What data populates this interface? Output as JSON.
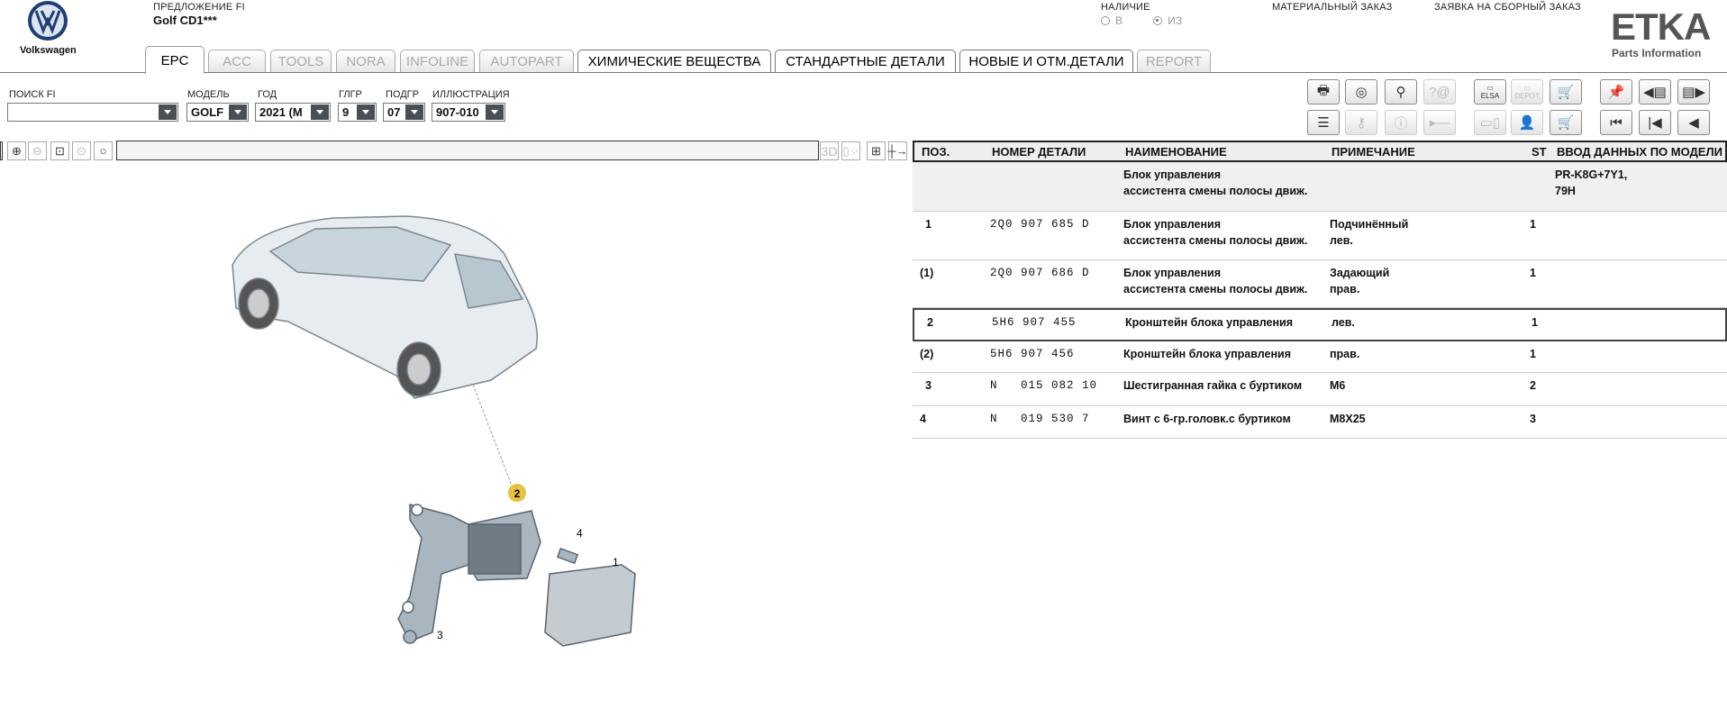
{
  "header": {
    "brand": "Volkswagen",
    "offer_label": "ПРЕДЛОЖЕНИЕ FI",
    "offer_value": "Golf CD1***",
    "availability_label": "НАЛИЧИЕ",
    "availability_options": [
      {
        "label": "В",
        "selected": false
      },
      {
        "label": "ИЗ",
        "selected": true
      }
    ],
    "material_order": "МАТЕРИАЛЬНЫЙ ЗАКАЗ",
    "assembly_order": "ЗАЯВКА НА СБОРНЫЙ ЗАКАЗ",
    "etka_logo": "ETKA",
    "etka_sub": "Parts Information"
  },
  "tabs": [
    {
      "label": "EPC",
      "state": "active"
    },
    {
      "label": "ACC",
      "state": "disabled"
    },
    {
      "label": "TOOLS",
      "state": "disabled"
    },
    {
      "label": "NORA",
      "state": "disabled"
    },
    {
      "label": "INFOLINE",
      "state": "disabled"
    },
    {
      "label": "AUTOPART",
      "state": "disabled"
    },
    {
      "label": "ХИМИЧЕСКИЕ ВЕЩЕСТВА",
      "state": "enabled"
    },
    {
      "label": "СТАНДАРТНЫЕ ДЕТАЛИ",
      "state": "enabled"
    },
    {
      "label": "НОВЫЕ И ОТМ.ДЕТАЛИ",
      "state": "enabled"
    },
    {
      "label": "REPORT",
      "state": "disabled"
    }
  ],
  "filters": [
    {
      "label": "ПОИСК FI",
      "value": ""
    },
    {
      "label": "МОДЕЛЬ",
      "value": "GOLF"
    },
    {
      "label": "ГОД",
      "value": "2021 (M"
    },
    {
      "label": "ГЛГР",
      "value": "9"
    },
    {
      "label": "ПОДГР",
      "value": "07"
    },
    {
      "label": "ИЛЛЮСТРАЦИЯ",
      "value": "907-010"
    }
  ],
  "toolbar": {
    "elsa": "ELSA",
    "depot": "DEPOT"
  },
  "viewer": {
    "btn_3d": "3D"
  },
  "table": {
    "headers": [
      "ПОЗ.",
      "НОМЕР ДЕТАЛИ",
      "НАИМЕНОВАНИЕ",
      "ПРИМЕЧАНИЕ",
      "ST",
      "ВВОД ДАННЫХ ПО МОДЕЛИ"
    ],
    "info_row": {
      "name1": "Блок управления",
      "name2": "ассистента смены полосы движ.",
      "model1": "PR-K8G+7Y1,",
      "model2": "79H"
    },
    "rows": [
      {
        "pos": "1",
        "part": "2Q0 907 685 D",
        "name1": "Блок управления",
        "name2": "ассистента смены полосы движ.",
        "note1": "Подчинённый",
        "note2": "лев.",
        "st": "1"
      },
      {
        "pos": "(1)",
        "part": "2Q0 907 686 D",
        "name1": "Блок управления",
        "name2": "ассистента смены полосы движ.",
        "note1": "Задающий",
        "note2": "прав.",
        "st": "1"
      },
      {
        "pos": "2",
        "part": "5H6 907 455",
        "name1": "Кронштейн блока управления",
        "name2": "",
        "note1": "лев.",
        "note2": "",
        "st": "1"
      },
      {
        "pos": "(2)",
        "part": "5H6 907 456",
        "name1": "Кронштейн блока управления",
        "name2": "",
        "note1": "прав.",
        "note2": "",
        "st": "1"
      },
      {
        "pos": "3",
        "part": "N   015 082 10",
        "name1": "Шестигранная гайка с буртиком",
        "name2": "",
        "note1": "M6",
        "note2": "",
        "st": "2"
      },
      {
        "pos": "4",
        "part": "N   019 530 7",
        "name1": "Винт с 6-гр.головк.с буртиком",
        "name2": "",
        "note1": "M8X25",
        "note2": "",
        "st": "3"
      }
    ]
  },
  "illustration": {
    "callouts": [
      "1",
      "2",
      "3",
      "4"
    ],
    "highlight_color": "#e8c23a"
  }
}
